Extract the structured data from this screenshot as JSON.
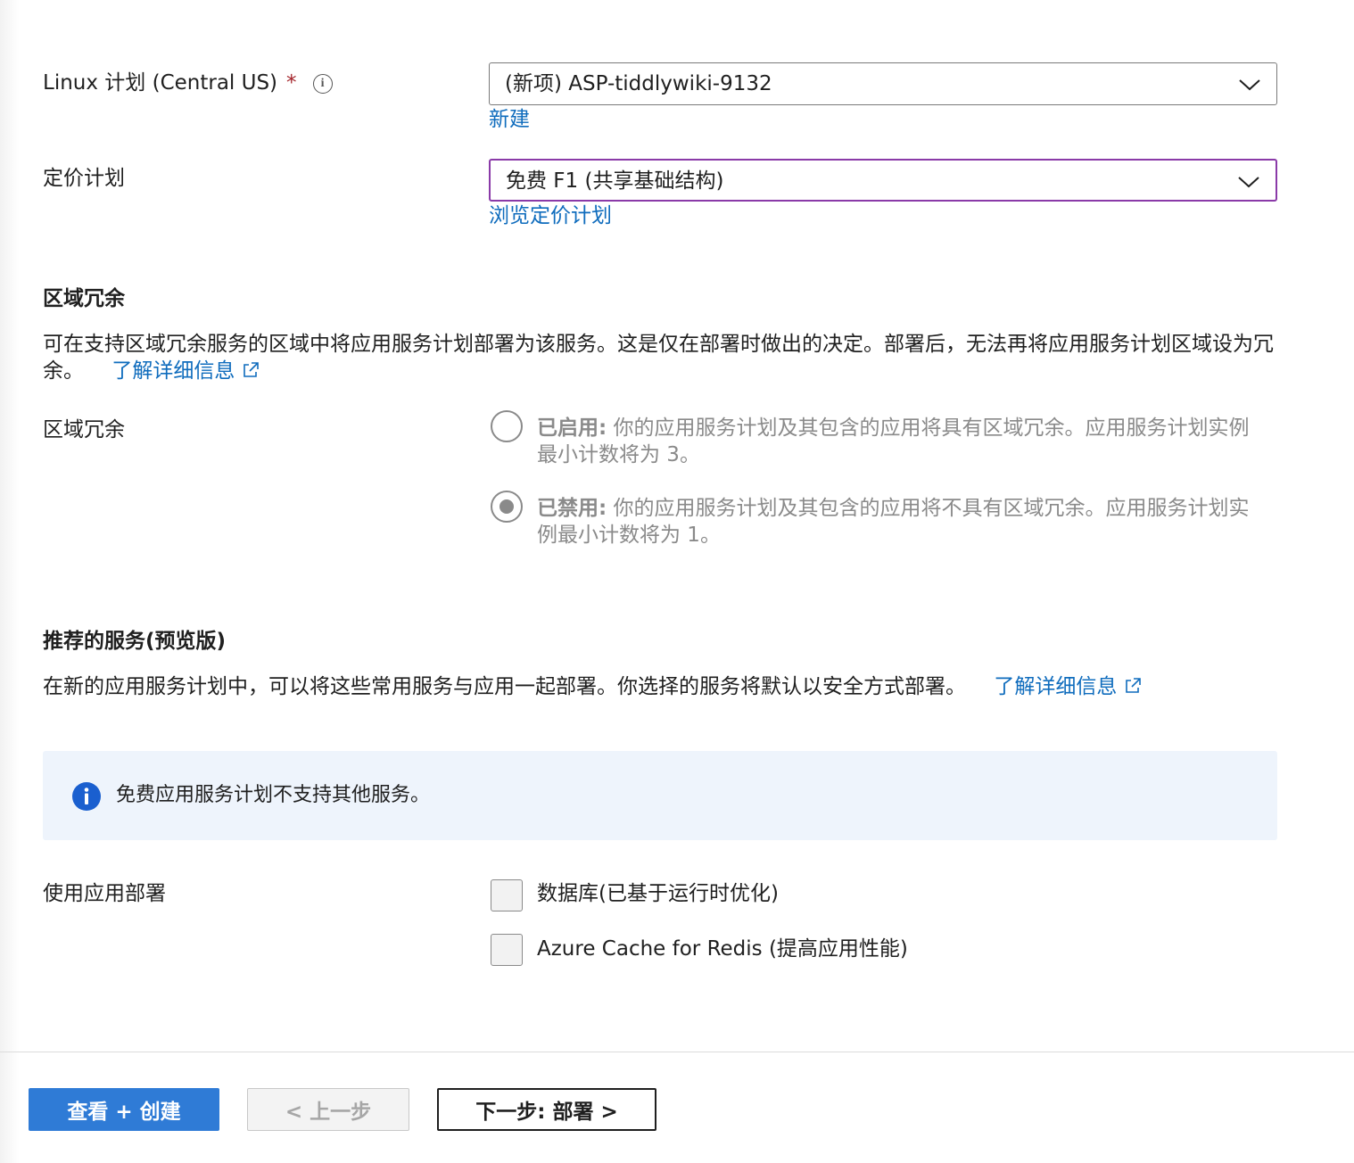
{
  "plan": {
    "label": "Linux 计划 (Central US)",
    "required_mark": "*",
    "info_glyph": "i",
    "selected_value": "(新项) ASP-tiddlywiki-9132",
    "create_new_link": "新建"
  },
  "pricing": {
    "label": "定价计划",
    "selected_value": "免费 F1 (共享基础结构)",
    "browse_link": "浏览定价计划"
  },
  "zone_redundancy": {
    "section_title": "区域冗余",
    "description": "可在支持区域冗余服务的区域中将应用服务计划部署为该服务。这是仅在部署时做出的决定。部署后，无法再将应用服务计划区域设为冗余。",
    "learn_more": "了解详细信息",
    "field_label": "区域冗余",
    "options": [
      {
        "title": "已启用:",
        "text": "你的应用服务计划及其包含的应用将具有区域冗余。应用服务计划实例最小计数将为 3。",
        "selected": false
      },
      {
        "title": "已禁用:",
        "text": "你的应用服务计划及其包含的应用将不具有区域冗余。应用服务计划实例最小计数将为 1。",
        "selected": true
      }
    ]
  },
  "recommended": {
    "section_title": "推荐的服务(预览版)",
    "description": "在新的应用服务计划中，可以将这些常用服务与应用一起部署。你选择的服务将默认以安全方式部署。",
    "learn_more": "了解详细信息",
    "info_message": "免费应用服务计划不支持其他服务。",
    "field_label": "使用应用部署",
    "checkboxes": [
      {
        "label": "数据库(已基于运行时优化)",
        "checked": false
      },
      {
        "label": "Azure Cache for Redis (提高应用性能)",
        "checked": false
      }
    ]
  },
  "footer": {
    "review_create": "查看 + 创建",
    "previous": "< 上一步",
    "next": "下一步: 部署 >"
  },
  "icons": {
    "dropdown": "chevron-down-icon",
    "external": "external-link-icon",
    "info": "info-icon"
  },
  "colors": {
    "link": "#0f6cbd",
    "primary_button": "#2f7bd6",
    "focus_border": "#8a3aa8",
    "info_box_bg": "#eef4fc",
    "info_icon": "#1a5fcf",
    "required": "#a4262c"
  }
}
